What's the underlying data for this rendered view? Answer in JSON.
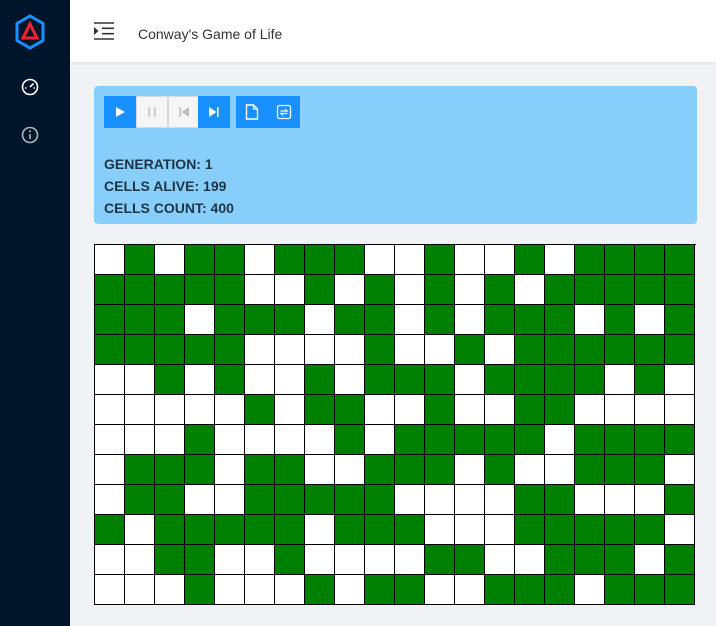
{
  "app": {
    "title": "Conway's Game of Life"
  },
  "sidebar": {
    "icons": [
      "dashboard-icon",
      "info-icon"
    ]
  },
  "toolbar": {
    "buttons": [
      "play",
      "pause",
      "step-back",
      "step-forward",
      "new-file",
      "reset"
    ]
  },
  "stats": {
    "generation": "GENERATION: 1",
    "alive": "CELLS ALIVE: 199",
    "count": "CELLS COUNT: 400"
  },
  "colors": {
    "alive": "#008000",
    "dead": "#ffffff",
    "accent": "#1890ff",
    "panel": "#87cefa"
  },
  "grid": {
    "columns": 20,
    "rows": [
      "01011011100100101111",
      "11111001010101011111",
      "11101110110101110101",
      "11111000010010111111",
      "00101001011101111010",
      "00000101100100110000",
      "00010000101111101111",
      "01110110011101001110",
      "01100111110000110001",
      "10111110111000111110",
      "00110010000110011101",
      "00010001011001110111"
    ]
  }
}
